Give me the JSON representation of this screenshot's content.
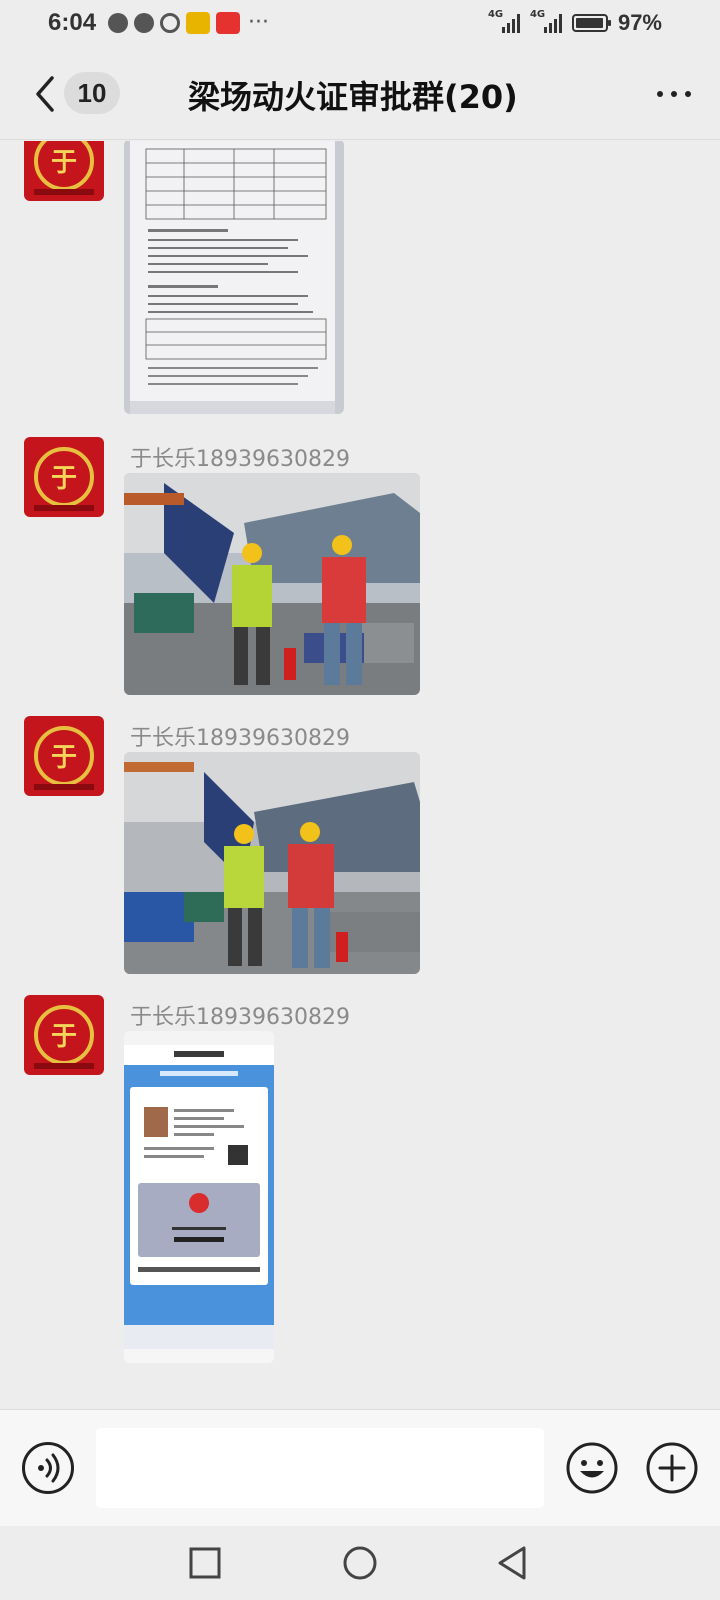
{
  "status_bar": {
    "time": "6:04",
    "network_1": "4G",
    "network_2": "4G",
    "battery_level": 0.97,
    "battery_text": "97%"
  },
  "header": {
    "back_icon": "chevron-left-icon",
    "unread_count": "10",
    "title": "梁场动火证审批群(20)",
    "more_icon": "more-icon"
  },
  "messages": [
    {
      "sender": "",
      "content_type": "image",
      "image": "permit-form-document"
    },
    {
      "sender": "于长乐18939630829",
      "content_type": "image",
      "image": "worksite-photo-workers-back"
    },
    {
      "sender": "于长乐18939630829",
      "content_type": "image",
      "image": "worksite-photo-workers-front"
    },
    {
      "sender": "于长乐18939630829",
      "content_type": "image",
      "image": "operator-certificate-screenshot"
    }
  ],
  "input_bar": {
    "voice_icon": "voice-icon",
    "text_value": "",
    "emoji_icon": "emoji-icon",
    "plus_icon": "plus-icon"
  },
  "nav_bar": {
    "recents_icon": "square-icon",
    "home_icon": "circle-icon",
    "back_icon": "triangle-back-icon"
  }
}
